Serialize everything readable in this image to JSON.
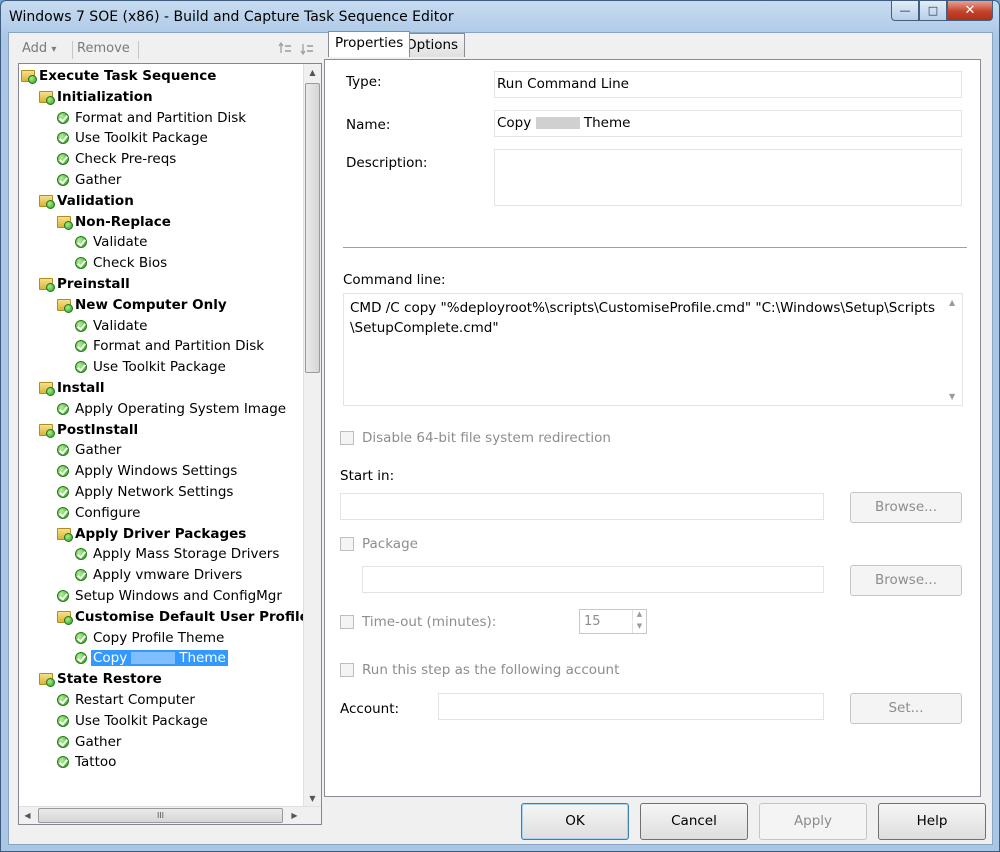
{
  "window": {
    "title": "Windows 7 SOE (x86) - Build and Capture Task Sequence Editor",
    "minimize_glyph": "—",
    "maximize_glyph": "□",
    "close_glyph": "✕"
  },
  "toolbar": {
    "add_label": "Add",
    "add_arrow": "▾",
    "remove_label": "Remove"
  },
  "tree": {
    "items": [
      {
        "label": "Execute Task Sequence",
        "type": "group",
        "level": 0
      },
      {
        "label": "Initialization",
        "type": "group",
        "level": 1
      },
      {
        "label": "Format and Partition Disk",
        "type": "step",
        "level": 2
      },
      {
        "label": "Use Toolkit Package",
        "type": "step",
        "level": 2
      },
      {
        "label": "Check Pre-reqs",
        "type": "step",
        "level": 2
      },
      {
        "label": "Gather",
        "type": "step",
        "level": 2
      },
      {
        "label": "Validation",
        "type": "group",
        "level": 1
      },
      {
        "label": "Non-Replace",
        "type": "group",
        "level": 2
      },
      {
        "label": "Validate",
        "type": "step",
        "level": 3
      },
      {
        "label": "Check Bios",
        "type": "step",
        "level": 3
      },
      {
        "label": "Preinstall",
        "type": "group",
        "level": 1
      },
      {
        "label": "New Computer Only",
        "type": "group",
        "level": 2
      },
      {
        "label": "Validate",
        "type": "step",
        "level": 3
      },
      {
        "label": "Format and Partition Disk",
        "type": "step",
        "level": 3
      },
      {
        "label": "Use Toolkit Package",
        "type": "step",
        "level": 3
      },
      {
        "label": "Install",
        "type": "group",
        "level": 1
      },
      {
        "label": "Apply Operating System Image",
        "type": "step",
        "level": 2
      },
      {
        "label": "PostInstall",
        "type": "group",
        "level": 1
      },
      {
        "label": "Gather",
        "type": "step",
        "level": 2
      },
      {
        "label": "Apply Windows Settings",
        "type": "step",
        "level": 2
      },
      {
        "label": "Apply Network Settings",
        "type": "step",
        "level": 2
      },
      {
        "label": "Configure",
        "type": "step",
        "level": 2
      },
      {
        "label": "Apply Driver Packages",
        "type": "group",
        "level": 2
      },
      {
        "label": "Apply Mass Storage Drivers",
        "type": "step",
        "level": 3
      },
      {
        "label": "Apply vmware Drivers",
        "type": "step",
        "level": 3
      },
      {
        "label": "Setup Windows and ConfigMgr",
        "type": "step",
        "level": 2
      },
      {
        "label": "Customise Default User Profile",
        "type": "group",
        "level": 2
      },
      {
        "label": "Copy Profile Theme",
        "type": "step",
        "level": 3
      },
      {
        "label": "Copy",
        "label_after": "Theme",
        "redacted": true,
        "type": "step",
        "level": 3,
        "selected": true
      },
      {
        "label": "State Restore",
        "type": "group",
        "level": 1
      },
      {
        "label": "Restart Computer",
        "type": "step",
        "level": 2
      },
      {
        "label": "Use Toolkit Package",
        "type": "step",
        "level": 2
      },
      {
        "label": "Gather",
        "type": "step",
        "level": 2
      },
      {
        "label": "Tattoo",
        "type": "step",
        "level": 2
      }
    ],
    "scroll_up": "▲",
    "scroll_down": "▼",
    "scroll_left": "◀",
    "scroll_right": "▶",
    "h_thumb_grip": "III"
  },
  "tabs": [
    {
      "label": "Properties",
      "active": true
    },
    {
      "label": "Options",
      "active": false
    }
  ],
  "properties": {
    "type_label": "Type:",
    "type_value": "Run Command Line",
    "name_label": "Name:",
    "name_value_before": "Copy",
    "name_value_after": "Theme",
    "description_label": "Description:",
    "description_value": "",
    "command_line_label": "Command line:",
    "command_line_value": "CMD /C copy \"%deployroot%\\scripts\\CustomiseProfile.cmd\" \"C:\\Windows\\Setup\\Scripts\\SetupComplete.cmd\"",
    "disable_64bit_label": "Disable 64-bit file system redirection",
    "start_in_label": "Start in:",
    "start_in_value": "",
    "browse_label": "Browse...",
    "package_label": "Package",
    "package_value": "",
    "browse2_label": "Browse...",
    "timeout_label": "Time-out (minutes):",
    "timeout_value": "15",
    "run_as_label": "Run this step as the following account",
    "account_label": "Account:",
    "account_value": "",
    "set_label": "Set..."
  },
  "buttons": {
    "ok": "OK",
    "cancel": "Cancel",
    "apply": "Apply",
    "help": "Help"
  }
}
